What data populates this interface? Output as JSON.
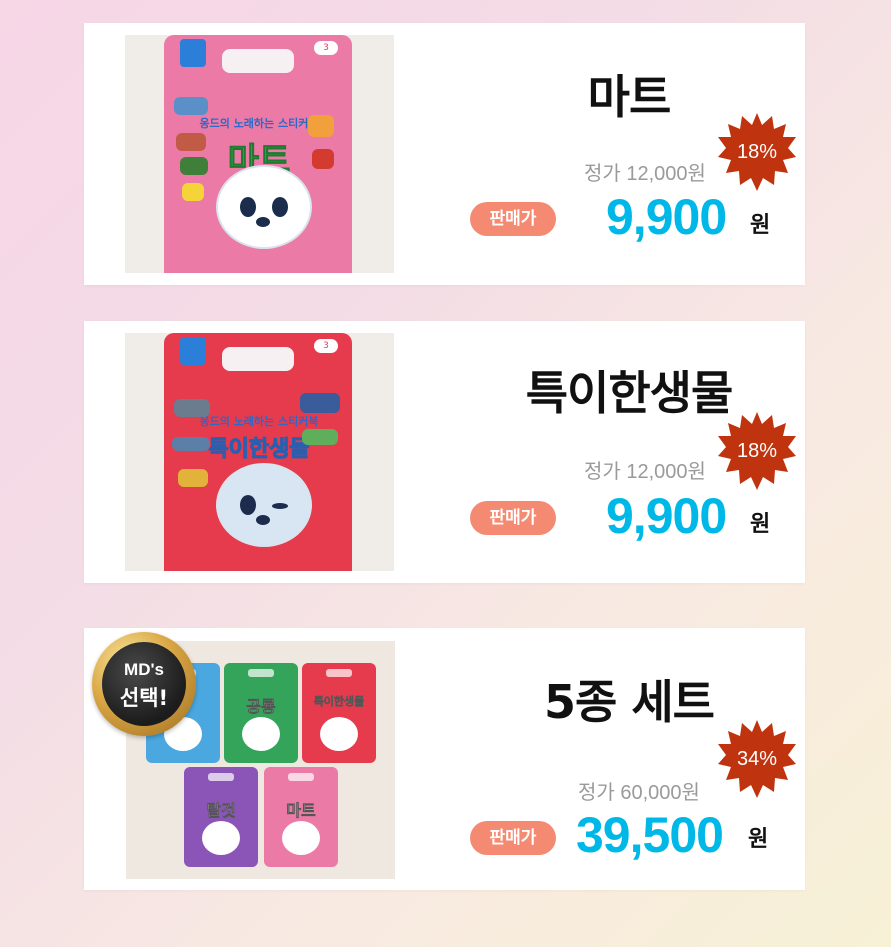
{
  "products": [
    {
      "title": "마트",
      "discount": "18%",
      "list_price": "정가 12,000원",
      "sale_label": "판매가",
      "sale_price": "9,900",
      "currency": "원",
      "book_series": "옹드의 노래하는 스티커북",
      "book_title": "마트",
      "cover_color": "#ec7aa6"
    },
    {
      "title": "특이한생물",
      "discount": "18%",
      "list_price": "정가 12,000원",
      "sale_label": "판매가",
      "sale_price": "9,900",
      "currency": "원",
      "book_series": "옹드의 노래하는 스티커북",
      "book_title": "특이한생물",
      "cover_color": "#e63a4d"
    },
    {
      "title": "5종 세트",
      "discount": "34%",
      "list_price": "정가 60,000원",
      "sale_label": "판매가",
      "sale_price": "39,500",
      "currency": "원",
      "md_badge_line1": "MD's",
      "md_badge_line2": "선택!",
      "set_books": [
        "",
        "공룡",
        "특이한생물",
        "탈것",
        "마트"
      ]
    }
  ],
  "colors": {
    "badge": "#c0330f",
    "sale_price": "#00b8e8",
    "sale_label_bg": "#f58a73",
    "list_price": "#9a9a9a"
  }
}
